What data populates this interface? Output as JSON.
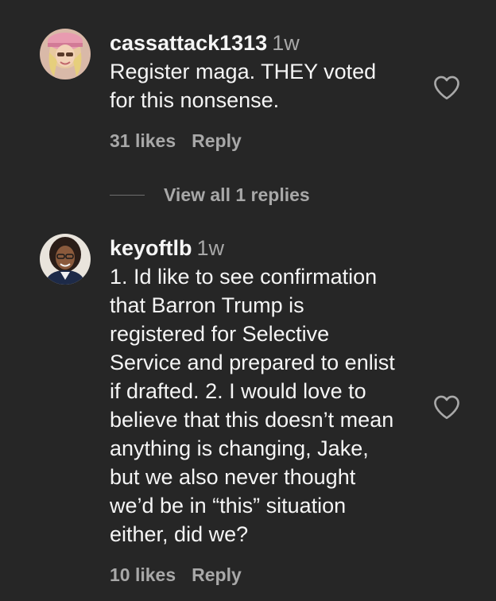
{
  "comments": [
    {
      "username": "cassattack1313",
      "time": "1w",
      "text": "Register maga. THEY voted\nfor this nonsense.",
      "likes": "31 likes",
      "reply_label": "Reply",
      "avatar_icon": "avatar-photo"
    },
    {
      "username": "keyoftlb",
      "time": "1w",
      "text": "1. Id like to see confirmation\nthat Barron Trump is\nregistered for Selective\nService and prepared to enlist\nif drafted. 2. I would love to\nbelieve that this doesn’t mean\nanything is changing, Jake,\nbut we also never thought\nwe’d be in “this” situation\neither, did we?",
      "likes": "10 likes",
      "reply_label": "Reply",
      "avatar_icon": "avatar-photo"
    }
  ],
  "view_replies": {
    "label": "View all 1 replies"
  },
  "icons": {
    "like": "heart-icon"
  },
  "colors": {
    "background": "#262626",
    "primary_text": "#f5f5f5",
    "secondary_text": "#a8a8a8"
  }
}
